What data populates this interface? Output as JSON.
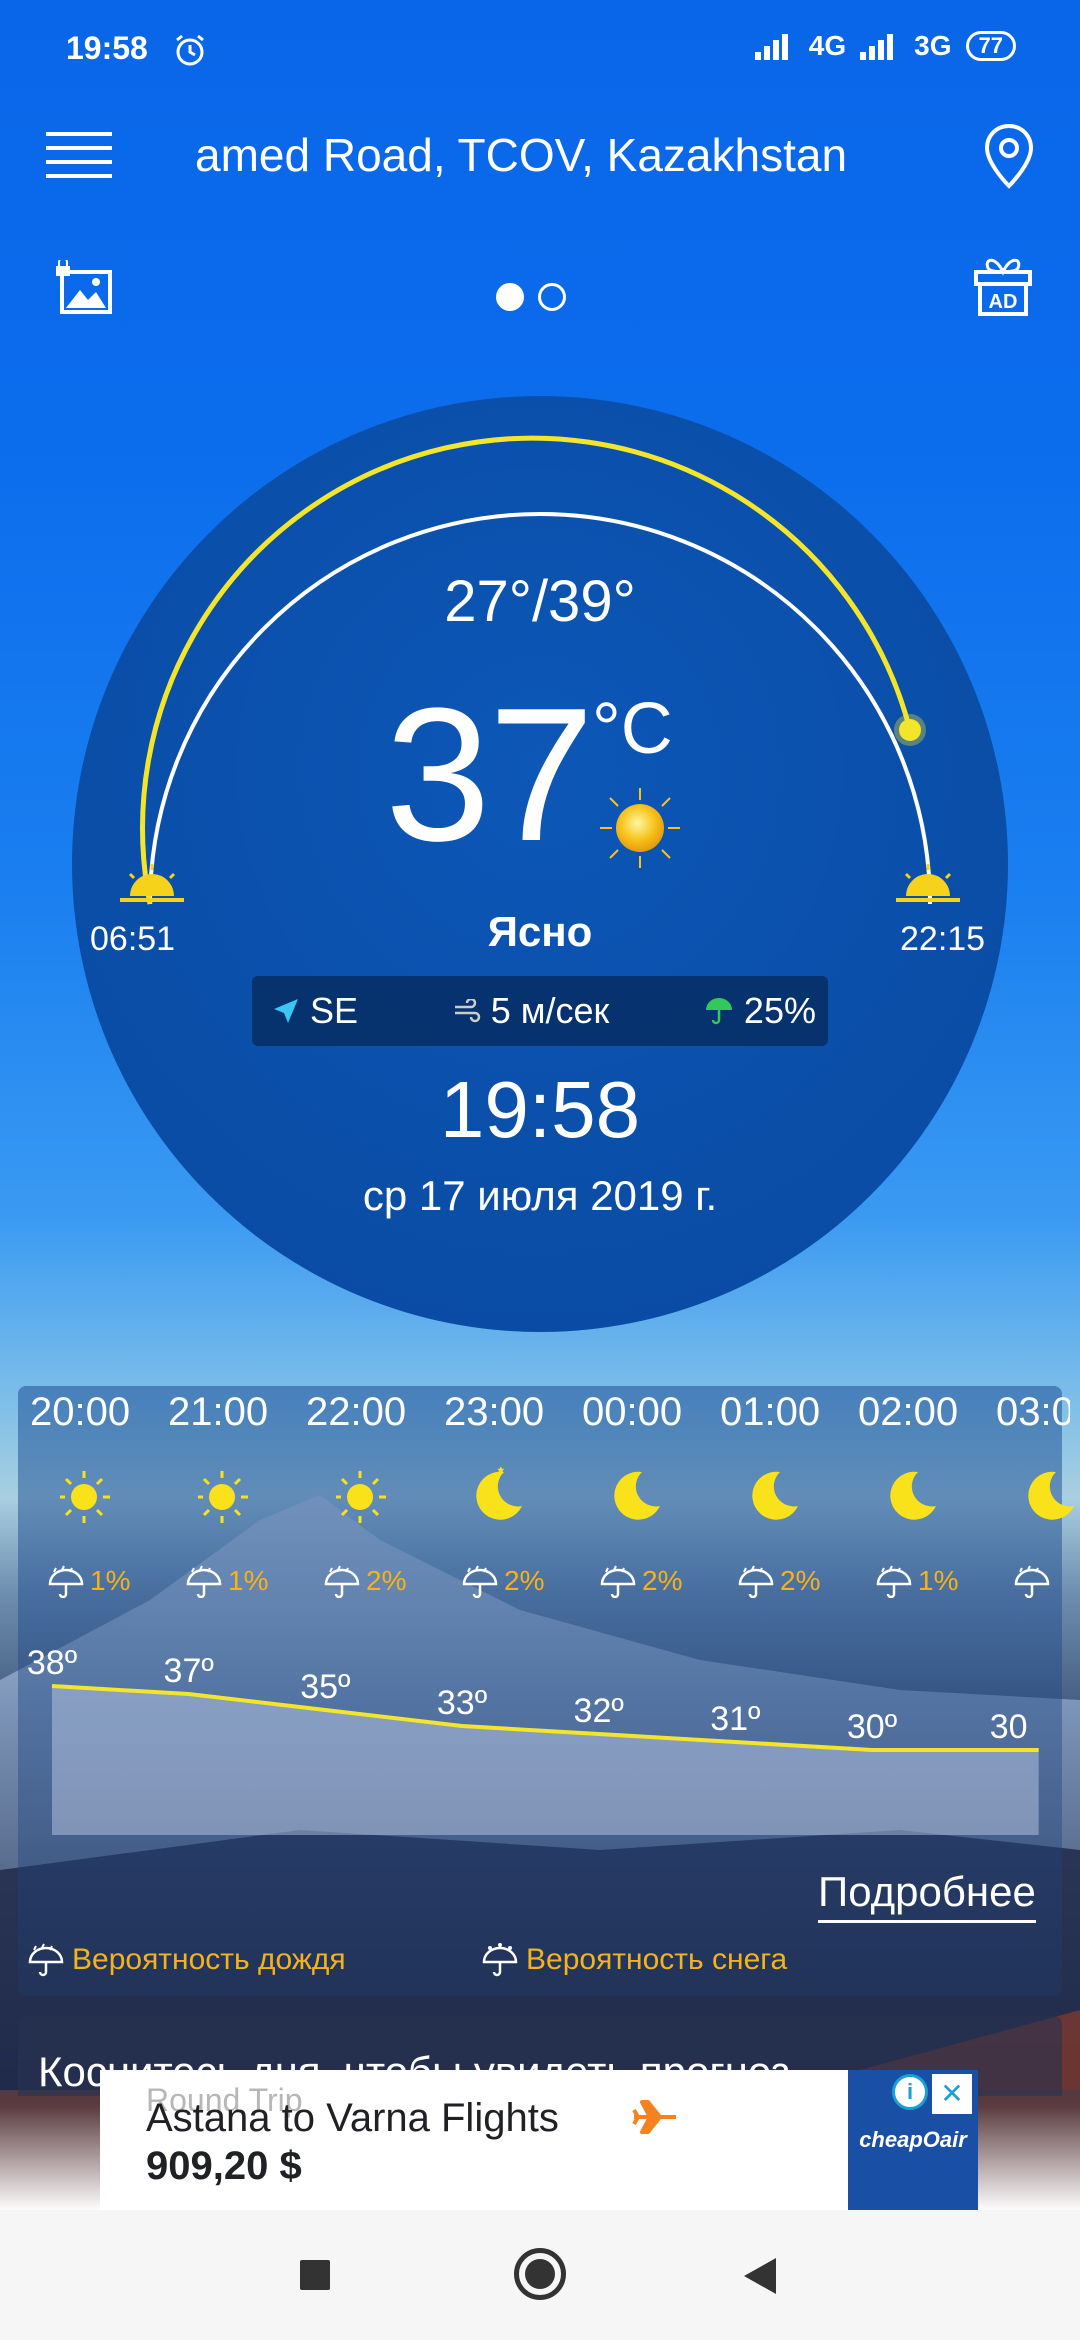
{
  "status_bar": {
    "time": "19:58",
    "network_1": "4G",
    "network_2": "3G",
    "battery": "77",
    "icons": [
      "alarm-icon",
      "signal-icon",
      "signal-icon",
      "battery-icon"
    ]
  },
  "header": {
    "location": "amed Road, TCOV, Kazakhstan",
    "menu_icon": "menu-icon",
    "pin_icon": "location-pin-icon"
  },
  "pager": {
    "count": 2,
    "active_index": 0
  },
  "current": {
    "hi_lo": "27°/39°",
    "temperature": "37",
    "unit": "°C",
    "condition": "Ясно",
    "sunrise": "06:51",
    "sunset": "22:15",
    "wind_direction": "SE",
    "wind_speed": "5 м/сек",
    "precip_chance": "25%",
    "time": "19:58",
    "date": "ср 17 июля 2019 г."
  },
  "hourly": {
    "hours": [
      "20:00",
      "21:00",
      "22:00",
      "23:00",
      "00:00",
      "01:00",
      "02:00",
      "03:0"
    ],
    "icons": [
      "sun-icon",
      "sun-icon",
      "sun-icon",
      "moon-icon",
      "moon-icon",
      "moon-icon",
      "moon-icon",
      "moon-icon"
    ],
    "precip": [
      "1%",
      "1%",
      "2%",
      "2%",
      "2%",
      "2%",
      "1%",
      ""
    ],
    "temps": [
      "38º",
      "37º",
      "35º",
      "33º",
      "32º",
      "31º",
      "30º",
      "30"
    ],
    "temp_values": [
      38,
      37,
      35,
      33,
      32,
      31,
      30,
      30
    ],
    "more_label": "Подробнее",
    "legend_rain": "Вероятность дождя",
    "legend_snow": "Вероятность снега"
  },
  "tap_hint": "Коснитесь дня, чтобы увидеть прогноз",
  "ad": {
    "ghost_text": "Round Trip",
    "title": "Astana to Varna Flights",
    "price": "909,20 $",
    "brand": "cheapOair",
    "info": "i",
    "close": "✕"
  },
  "colors": {
    "accent_yellow": "#f3e62a",
    "precip_orange": "#f6b21a",
    "circle_blue": "#0a4ea8",
    "sky_blue": "#0b6cec"
  }
}
